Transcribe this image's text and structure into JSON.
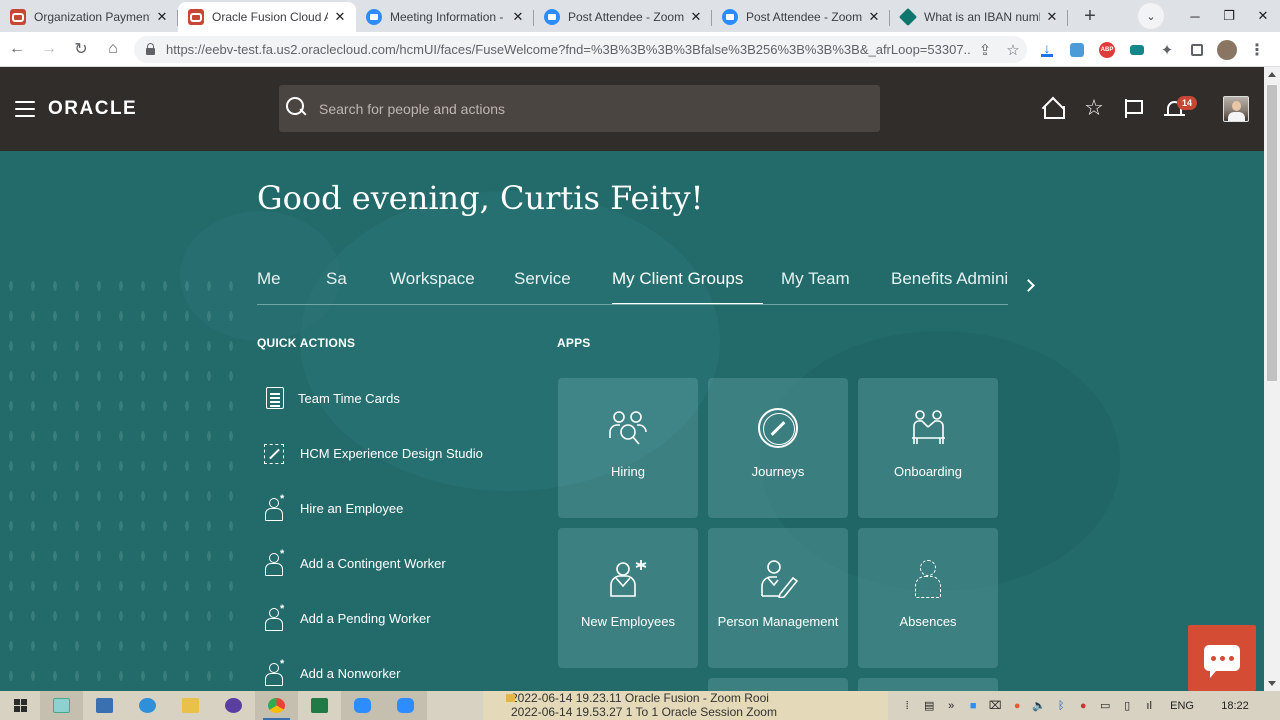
{
  "browser": {
    "tabs": [
      {
        "title": "Organization Payment M",
        "favicon": "oracle-favicon",
        "active": false
      },
      {
        "title": "Oracle Fusion Cloud Ap",
        "favicon": "oracle-favicon",
        "active": true
      },
      {
        "title": "Meeting Information - Z",
        "favicon": "zoom-favicon",
        "active": false
      },
      {
        "title": "Post Attendee - Zoom",
        "favicon": "zoom-favicon",
        "active": false
      },
      {
        "title": "Post Attendee - Zoom",
        "favicon": "zoom-favicon",
        "active": false
      },
      {
        "title": "What is an IBAN numbe",
        "favicon": "diamond-favicon",
        "active": false
      }
    ],
    "url": "https://eebv-test.fa.us2.oraclecloud.com/hcmUI/faces/FuseWelcome?fnd=%3B%3B%3B%3Bfalse%3B256%3B%3B%3B&_afrLoop=53307...",
    "extensions": [
      "download-icon",
      "translate-icon",
      "adblock-icon",
      "media-icon",
      "puzzle-icon",
      "sidebar-icon",
      "profile-avatar-icon",
      "menu-dots-icon"
    ],
    "extension_labels": {
      "adblock": "ABP"
    }
  },
  "header": {
    "logo": "ORACLE",
    "search_placeholder": "Search for people and actions",
    "notification_count": "14"
  },
  "colors": {
    "header_bg": "#312d2a",
    "springboard_bg": "#236a6b",
    "accent_red": "#c74634",
    "chat_red": "#d44c33"
  },
  "main": {
    "greeting": "Good evening, Curtis Feity!",
    "nav_tabs": [
      {
        "label": "Me",
        "selected": false
      },
      {
        "label": "Sa",
        "selected": false
      },
      {
        "label": "Workspace",
        "selected": false
      },
      {
        "label": "Service",
        "selected": false
      },
      {
        "label": "My Client Groups",
        "selected": true
      },
      {
        "label": "My Team",
        "selected": false
      },
      {
        "label": "Benefits Adminis",
        "selected": false
      }
    ],
    "quick_actions_title": "QUICK ACTIONS",
    "quick_actions": [
      {
        "label": "Team Time Cards",
        "icon": "document-icon"
      },
      {
        "label": "HCM Experience Design Studio",
        "icon": "design-studio-icon"
      },
      {
        "label": "Hire an Employee",
        "icon": "person-add-icon"
      },
      {
        "label": "Add a Contingent Worker",
        "icon": "person-add-icon"
      },
      {
        "label": "Add a Pending Worker",
        "icon": "person-add-icon"
      },
      {
        "label": "Add a Nonworker",
        "icon": "person-add-icon"
      }
    ],
    "apps_title": "APPS",
    "apps": [
      {
        "label": "Hiring",
        "icon": "hiring-icon"
      },
      {
        "label": "Journeys",
        "icon": "compass-icon"
      },
      {
        "label": "Onboarding",
        "icon": "onboarding-icon"
      },
      {
        "label": "New Employees",
        "icon": "new-employee-icon"
      },
      {
        "label": "Person Management",
        "icon": "person-management-icon"
      },
      {
        "label": "Absences",
        "icon": "absence-icon"
      }
    ]
  },
  "taskbar": {
    "zoom_window_lines": [
      "2022-06-14 19.23.11 Oracle Fusion - Zoom Rooi",
      "2022-06-14 19.53.27 1 To 1 Oracle Session Zoom"
    ],
    "language": "ENG",
    "time": "18:22"
  }
}
